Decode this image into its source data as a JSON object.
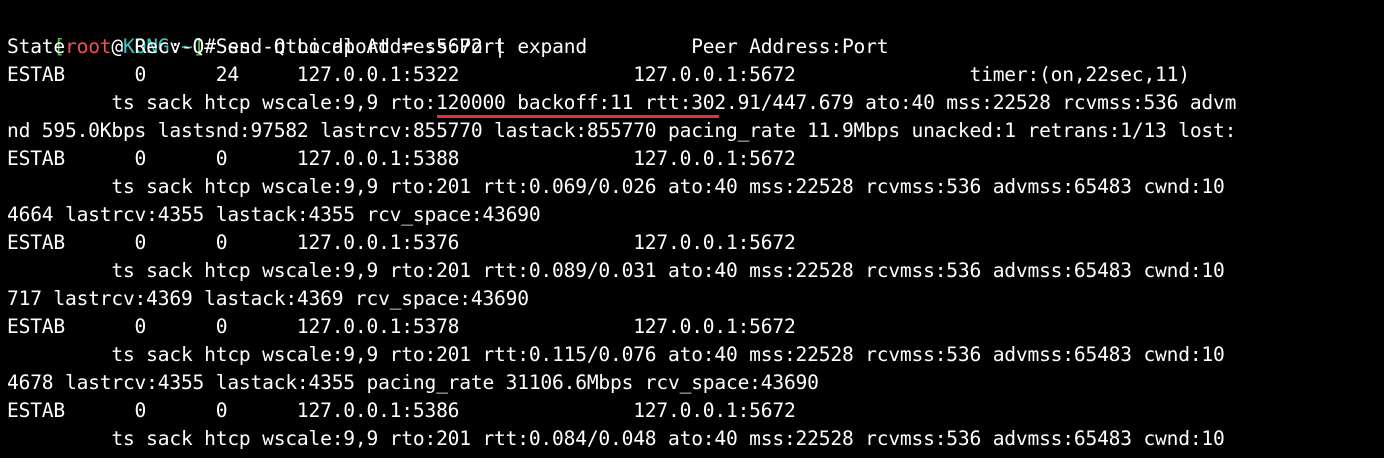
{
  "terminal": {
    "prompt": {
      "open_bracket": "[",
      "user": "root",
      "at": "@",
      "host": "KONG",
      "colon": ":",
      "path": "~",
      "close_bracket": "]",
      "symbol": "# "
    },
    "command": "ss -ntoi dport = :5672 | expand",
    "output": [
      "State      Recv-Q Send-Q Local Address:Port                Peer Address:Port",
      "ESTAB      0      24     127.0.0.1:5322               127.0.0.1:5672               timer:(on,22sec,11)",
      "         ts sack htcp wscale:9,9 rto:120000 backoff:11 rtt:302.91/447.679 ato:40 mss:22528 rcvmss:536 advm",
      "nd 595.0Kbps lastsnd:97582 lastrcv:855770 lastack:855770 pacing_rate 11.9Mbps unacked:1 retrans:1/13 lost:",
      "ESTAB      0      0      127.0.0.1:5388               127.0.0.1:5672",
      "         ts sack htcp wscale:9,9 rto:201 rtt:0.069/0.026 ato:40 mss:22528 rcvmss:536 advmss:65483 cwnd:10",
      "4664 lastrcv:4355 lastack:4355 rcv_space:43690",
      "ESTAB      0      0      127.0.0.1:5376               127.0.0.1:5672",
      "         ts sack htcp wscale:9,9 rto:201 rtt:0.089/0.031 ato:40 mss:22528 rcvmss:536 advmss:65483 cwnd:10",
      "717 lastrcv:4369 lastack:4369 rcv_space:43690",
      "ESTAB      0      0      127.0.0.1:5378               127.0.0.1:5672",
      "         ts sack htcp wscale:9,9 rto:201 rtt:0.115/0.076 ato:40 mss:22528 rcvmss:536 advmss:65483 cwnd:10",
      "4678 lastrcv:4355 lastack:4355 pacing_rate 31106.6Mbps rcv_space:43690",
      "ESTAB      0      0      127.0.0.1:5386               127.0.0.1:5672",
      "         ts sack htcp wscale:9,9 rto:201 rtt:0.084/0.048 ato:40 mss:22528 rcvmss:536 advmss:65483 cwnd:10"
    ],
    "highlight": {
      "text": "rto:120000 backoff:11",
      "color": "#e8303a"
    }
  },
  "colors": {
    "background": "#000000",
    "text": "#ffffff",
    "prompt_bracket": "#4ec24e",
    "prompt_user": "#f05050",
    "prompt_host": "#3fc7c7",
    "annotation": "#e8303a"
  }
}
